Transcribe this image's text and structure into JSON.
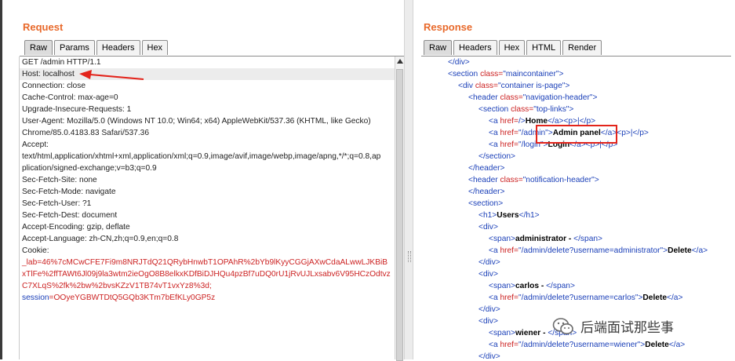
{
  "request": {
    "title": "Request",
    "tabs": [
      {
        "label": "Raw",
        "active": true
      },
      {
        "label": "Params",
        "active": false
      },
      {
        "label": "Headers",
        "active": false
      },
      {
        "label": "Hex",
        "active": false
      }
    ],
    "lines": [
      "GET /admin HTTP/1.1",
      "Host: localhost",
      "Connection: close",
      "Cache-Control: max-age=0",
      "Upgrade-Insecure-Requests: 1",
      "User-Agent: Mozilla/5.0 (Windows NT 10.0; Win64; x64) AppleWebKit/537.36 (KHTML, like Gecko)",
      "Chrome/85.0.4183.83 Safari/537.36",
      "Accept:",
      "text/html,application/xhtml+xml,application/xml;q=0.9,image/avif,image/webp,image/apng,*/*;q=0.8,ap",
      "plication/signed-exchange;v=b3;q=0.9",
      "Sec-Fetch-Site: none",
      "Sec-Fetch-Mode: navigate",
      "Sec-Fetch-User: ?1",
      "Sec-Fetch-Dest: document",
      "Accept-Encoding: gzip, deflate",
      "Accept-Language: zh-CN,zh;q=0.9,en;q=0.8",
      "Cookie:"
    ],
    "cookie_lines": [
      "_lab=46%7cMCwCFE7Fi9m8NRJTdQ21QRybHnwbT1OPAhR%2bYb9lKyyCGGjAXwCdaALwwLJKBiB",
      "xTlFe%2ffTAWt6Jl09j9la3wtm2ieOgO8B8elkxKDfBiDJHQu4pzBf7uDQ0rU1jRvUJLxsabv6V95HCzOdtvz",
      "C7XLqS%2fk%2bw%2bvsKZzV1TB74vT1vxYz8%3d;"
    ],
    "session_key": "session",
    "session_value": "=OOyeYGBWTDtQ5GQb3KTm7bEfKLy0GP5z"
  },
  "response": {
    "title": "Response",
    "tabs": [
      {
        "label": "Raw",
        "active": true
      },
      {
        "label": "Headers",
        "active": false
      },
      {
        "label": "Hex",
        "active": false
      },
      {
        "label": "HTML",
        "active": false
      },
      {
        "label": "Render",
        "active": false
      }
    ],
    "lines": [
      {
        "indent": 1,
        "parts": [
          [
            "tag",
            "</div>"
          ]
        ]
      },
      {
        "indent": 1,
        "parts": [
          [
            "tag",
            "<section "
          ],
          [
            "attr",
            "class="
          ],
          [
            "tag",
            "\"maincontainer\">"
          ]
        ]
      },
      {
        "indent": 2,
        "parts": [
          [
            "tag",
            "<div "
          ],
          [
            "attr",
            "class="
          ],
          [
            "tag",
            "\"container is-page\">"
          ]
        ]
      },
      {
        "indent": 3,
        "parts": [
          [
            "tag",
            "<header "
          ],
          [
            "attr",
            "class="
          ],
          [
            "tag",
            "\"navigation-header\">"
          ]
        ]
      },
      {
        "indent": 4,
        "parts": [
          [
            "tag",
            "<section "
          ],
          [
            "attr",
            "class="
          ],
          [
            "tag",
            "\"top-links\">"
          ]
        ]
      },
      {
        "indent": 5,
        "parts": [
          [
            "tag",
            "<a "
          ],
          [
            "attr",
            "href="
          ],
          [
            "tag",
            "/>"
          ],
          [
            "txt",
            "Home"
          ],
          [
            "tag",
            "</a><p>|</p>"
          ]
        ]
      },
      {
        "indent": 5,
        "parts": [
          [
            "tag",
            "<a "
          ],
          [
            "attr",
            "href="
          ],
          [
            "tag",
            "\"/admin\">"
          ],
          [
            "txt",
            "Admin panel"
          ],
          [
            "tag",
            "</a><p>|</p>"
          ]
        ]
      },
      {
        "indent": 5,
        "parts": [
          [
            "tag",
            "<a "
          ],
          [
            "attr",
            "href="
          ],
          [
            "tag",
            "\"/login\">"
          ],
          [
            "txt",
            "Login"
          ],
          [
            "tag",
            "</a><p>|</p>"
          ]
        ]
      },
      {
        "indent": 4,
        "parts": [
          [
            "tag",
            "</section>"
          ]
        ]
      },
      {
        "indent": 3,
        "parts": [
          [
            "tag",
            "</header>"
          ]
        ]
      },
      {
        "indent": 3,
        "parts": [
          [
            "tag",
            "<header "
          ],
          [
            "attr",
            "class="
          ],
          [
            "tag",
            "\"notification-header\">"
          ]
        ]
      },
      {
        "indent": 3,
        "parts": [
          [
            "tag",
            "</header>"
          ]
        ]
      },
      {
        "indent": 3,
        "parts": [
          [
            "tag",
            "<section>"
          ]
        ]
      },
      {
        "indent": 4,
        "parts": [
          [
            "tag",
            "<h1>"
          ],
          [
            "txt",
            "Users"
          ],
          [
            "tag",
            "</h1>"
          ]
        ]
      },
      {
        "indent": 4,
        "parts": [
          [
            "tag",
            "<div>"
          ]
        ]
      },
      {
        "indent": 5,
        "parts": [
          [
            "tag",
            "<span>"
          ],
          [
            "txt",
            "administrator - "
          ],
          [
            "tag",
            "</span>"
          ]
        ]
      },
      {
        "indent": 5,
        "parts": [
          [
            "tag",
            "<a "
          ],
          [
            "attr",
            "href="
          ],
          [
            "tag",
            "\"/admin/delete?username=administrator\">"
          ],
          [
            "txt",
            "Delete"
          ],
          [
            "tag",
            "</a>"
          ]
        ]
      },
      {
        "indent": 4,
        "parts": [
          [
            "tag",
            "</div>"
          ]
        ]
      },
      {
        "indent": 4,
        "parts": [
          [
            "tag",
            "<div>"
          ]
        ]
      },
      {
        "indent": 5,
        "parts": [
          [
            "tag",
            "<span>"
          ],
          [
            "txt",
            "carlos - "
          ],
          [
            "tag",
            "</span>"
          ]
        ]
      },
      {
        "indent": 5,
        "parts": [
          [
            "tag",
            "<a "
          ],
          [
            "attr",
            "href="
          ],
          [
            "tag",
            "\"/admin/delete?username=carlos\">"
          ],
          [
            "txt",
            "Delete"
          ],
          [
            "tag",
            "</a>"
          ]
        ]
      },
      {
        "indent": 4,
        "parts": [
          [
            "tag",
            "</div>"
          ]
        ]
      },
      {
        "indent": 4,
        "parts": [
          [
            "tag",
            "<div>"
          ]
        ]
      },
      {
        "indent": 5,
        "parts": [
          [
            "tag",
            "<span>"
          ],
          [
            "txt",
            "wiener - "
          ],
          [
            "tag",
            "</span>"
          ]
        ]
      },
      {
        "indent": 5,
        "parts": [
          [
            "tag",
            "<a "
          ],
          [
            "attr",
            "href="
          ],
          [
            "tag",
            "\"/admin/delete?username=wiener\">"
          ],
          [
            "txt",
            "Delete"
          ],
          [
            "tag",
            "</a>"
          ]
        ]
      },
      {
        "indent": 4,
        "parts": [
          [
            "tag",
            "</div>"
          ]
        ]
      }
    ]
  },
  "watermark": {
    "text": "后端面试那些事",
    "icon": "wechat-icon"
  },
  "colors": {
    "title": "#e8692b",
    "annotation": "#e3241b",
    "tag": "#1a3fb8",
    "attr": "#cc2222"
  }
}
